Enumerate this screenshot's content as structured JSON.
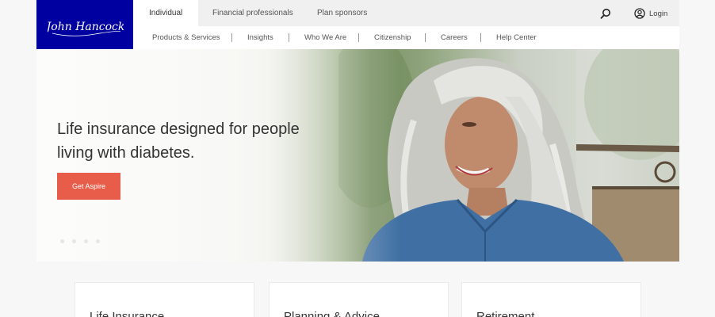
{
  "brand": {
    "logo_text": "John Hancock",
    "logo_color": "#0000a0"
  },
  "audience_tabs": [
    {
      "label": "Individual",
      "active": true
    },
    {
      "label": "Financial professionals",
      "active": false
    },
    {
      "label": "Plan sponsors",
      "active": false
    }
  ],
  "utility": {
    "search_icon": "search-icon",
    "login_label": "Login",
    "login_icon": "user-circle-icon"
  },
  "nav": {
    "items": [
      {
        "label": "Products & Services"
      },
      {
        "label": "Insights"
      },
      {
        "label": "Who We Are"
      },
      {
        "label": "Citizenship"
      },
      {
        "label": "Careers"
      },
      {
        "label": "Help Center"
      }
    ]
  },
  "hero": {
    "headline": "Life insurance designed for people living with diabetes.",
    "cta_label": "Get Aspire",
    "cta_color": "#e85d49"
  },
  "cards": [
    {
      "title": "Life Insurance"
    },
    {
      "title": "Planning & Advice"
    },
    {
      "title": "Retirement"
    }
  ]
}
